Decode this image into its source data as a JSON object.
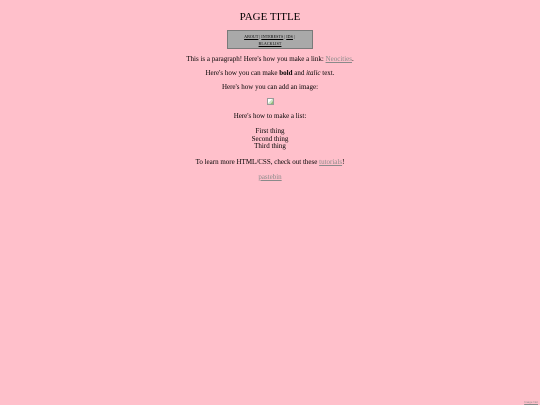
{
  "page": {
    "title": "PAGE TITLE"
  },
  "nav": {
    "items": [
      "about",
      "interests",
      "ids",
      "blacklist"
    ]
  },
  "content": {
    "para1_before": "This is a paragraph! Here's how you make a link: ",
    "para1_link": "Neocities",
    "para1_after": ".",
    "para2_before": "Here's how you can make ",
    "para2_bold": "bold",
    "para2_mid": " and ",
    "para2_italic": "italic",
    "para2_after": " text.",
    "para3": "Here's how you can add an image:",
    "para4": "Here's how to make a list:",
    "list_items": [
      "First thing",
      "Second thing",
      "Third thing"
    ],
    "para5_before": "To learn more HTML/CSS, check out these ",
    "para5_link": "tutorials",
    "para5_after": "!",
    "pastebin_link": "pastebin"
  },
  "corner_label": "Image Not",
  "colors": {
    "background": "#ffc0cb",
    "nav_bg": "#a9a9a9",
    "link": "#8a8a8a"
  }
}
